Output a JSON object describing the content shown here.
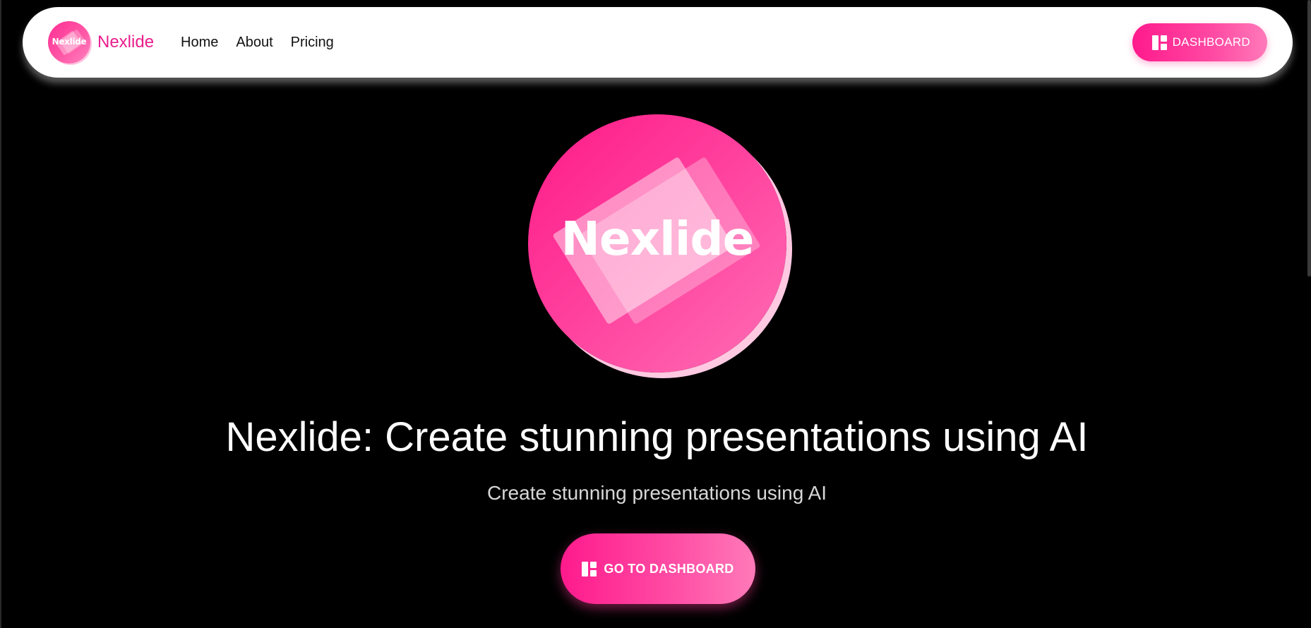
{
  "navbar": {
    "brand_logo_text": "Nexlide",
    "brand_name": "Nexlide",
    "links": [
      {
        "label": "Home"
      },
      {
        "label": "About"
      },
      {
        "label": "Pricing"
      }
    ],
    "dashboard_button": {
      "label": "DASHBOARD",
      "icon": "dashboard-icon"
    }
  },
  "hero": {
    "logo_text": "Nexlide",
    "title": "Nexlide: Create stunning presentations using AI",
    "subtitle": "Create stunning presentations using AI",
    "cta_button": {
      "label": "GO TO DASHBOARD",
      "icon": "dashboard-icon"
    }
  },
  "colors": {
    "accent": "#ff1a8c",
    "brand_text": "#e91e8c",
    "background": "#000000",
    "navbar_bg": "#ffffff"
  }
}
